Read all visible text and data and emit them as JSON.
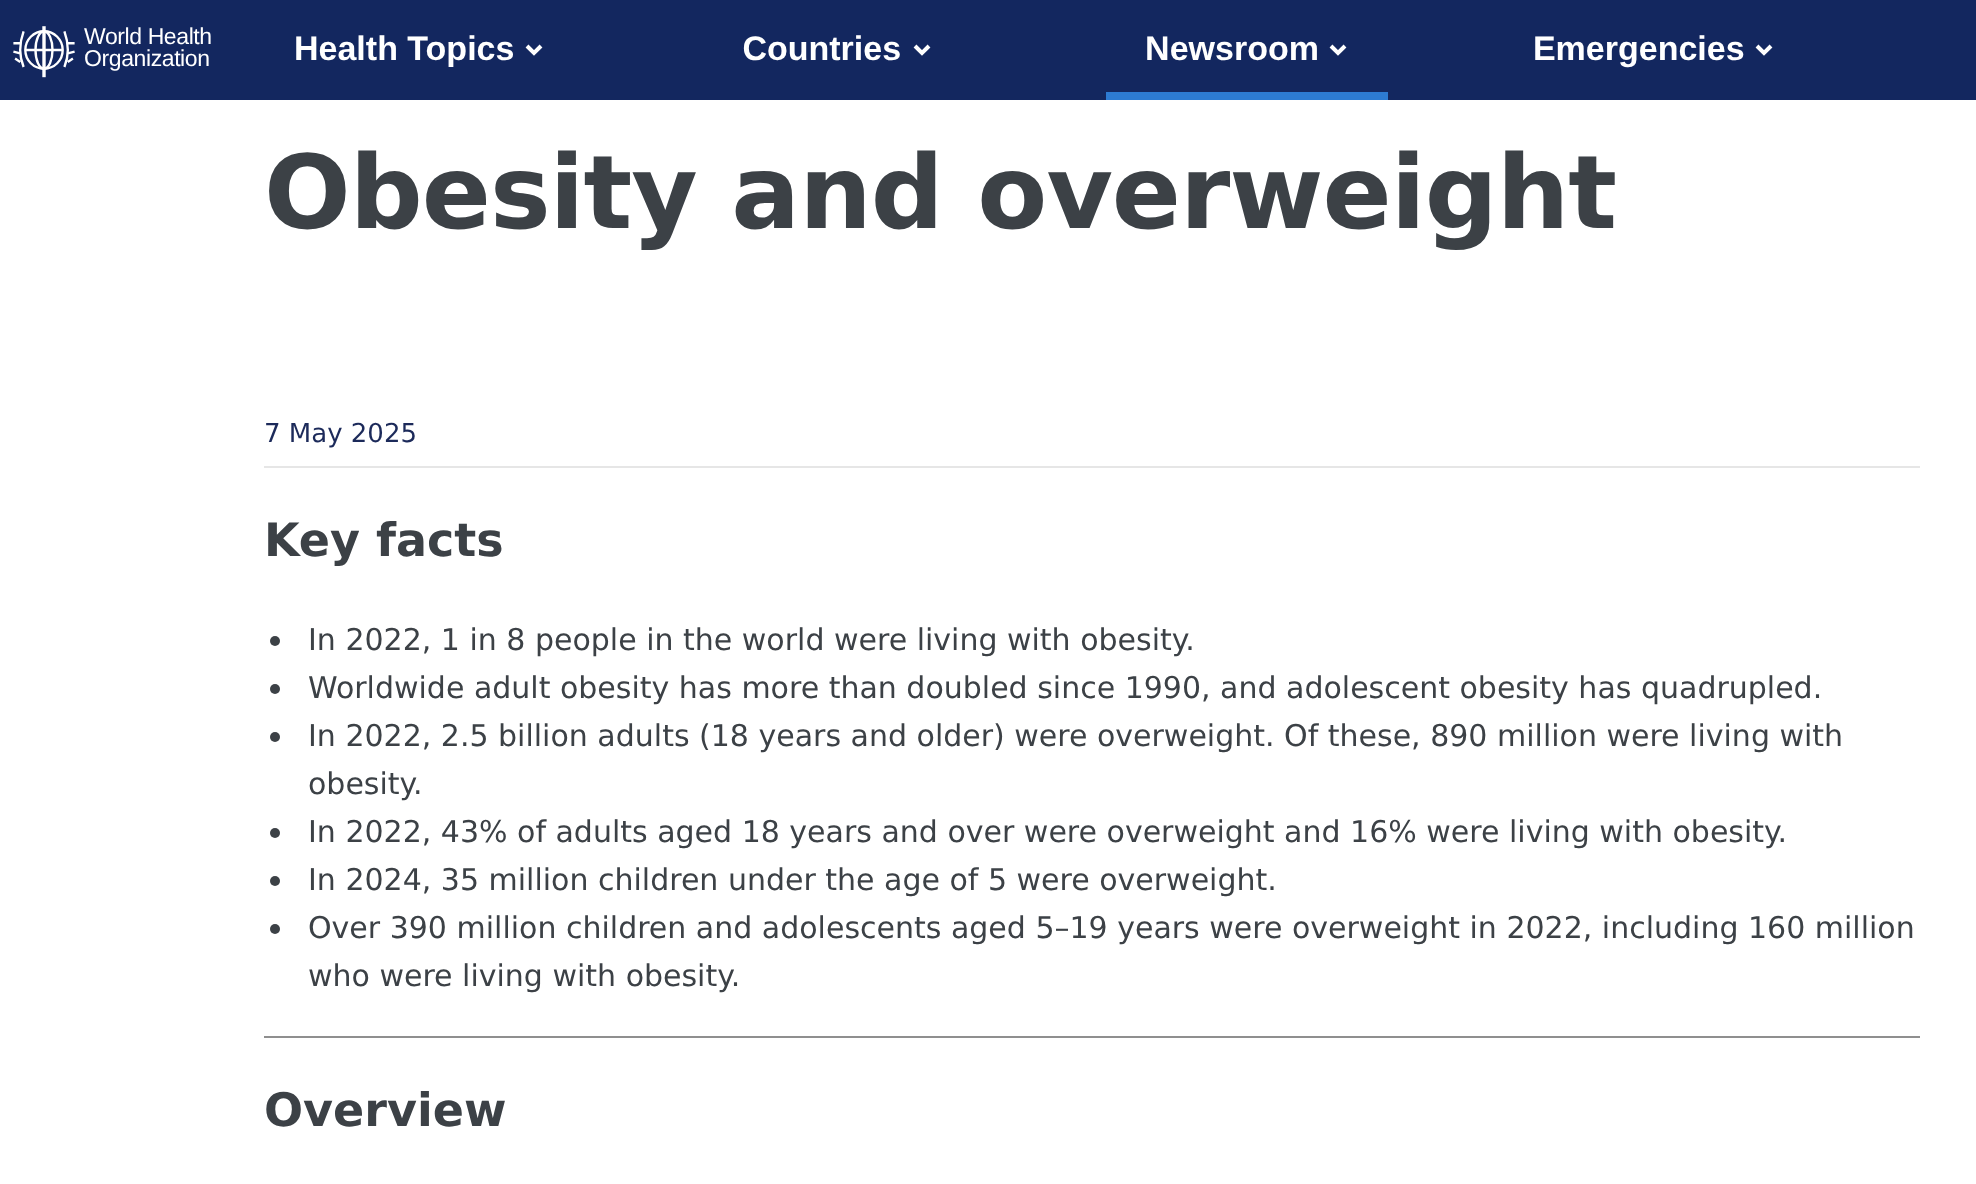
{
  "header": {
    "logo_text": [
      "World Health",
      "Organization"
    ],
    "nav": [
      {
        "label": "Health Topics",
        "selected": false
      },
      {
        "label": "Countries",
        "selected": false
      },
      {
        "label": "Newsroom",
        "selected": true
      },
      {
        "label": "Emergencies",
        "selected": false
      }
    ]
  },
  "article": {
    "title": "Obesity and overweight",
    "date": "7 May 2025",
    "sections": [
      {
        "heading": "Key facts",
        "items": [
          "In 2022, 1 in 8 people in the world were living with obesity.",
          "Worldwide adult obesity has more than doubled since 1990, and adolescent obesity has quadrupled.",
          "In 2022, 2.5 billion adults (18 years and older) were overweight. Of these, 890 million were living with obesity.",
          "In 2022, 43% of adults aged 18 years and over were overweight and 16% were living with obesity.",
          "In 2024, 35 million children under the age of 5 were overweight.",
          "Over 390 million children and adolescents aged 5–19 years were overweight in 2022, including 160 million who were living with obesity."
        ]
      },
      {
        "heading": "Overview"
      }
    ]
  }
}
